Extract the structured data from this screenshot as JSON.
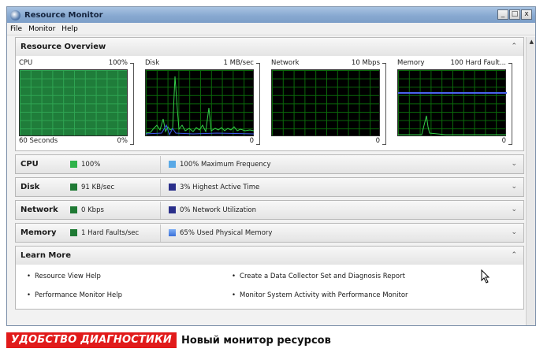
{
  "window": {
    "title": "Resource Monitor",
    "controls": [
      "_",
      "□",
      "x"
    ]
  },
  "menu": [
    "File",
    "Monitor",
    "Help"
  ],
  "overview": {
    "title": "Resource Overview",
    "graphs": {
      "cpu": {
        "name": "CPU",
        "max": "100%",
        "min": "0%",
        "duration": "60 Seconds"
      },
      "disk": {
        "name": "Disk",
        "max": "1 MB/sec",
        "min": "0"
      },
      "network": {
        "name": "Network",
        "max": "10 Mbps",
        "min": "0"
      },
      "memory": {
        "name": "Memory",
        "max": "100 Hard Fault...",
        "min": "0"
      }
    }
  },
  "sections": {
    "cpu": {
      "title": "CPU",
      "stat1": "100%",
      "stat2": "100% Maximum Frequency",
      "color1": "#2fb34a",
      "color2": "#5aa9e6"
    },
    "disk": {
      "title": "Disk",
      "stat1": "91 KB/sec",
      "stat2": "3% Highest Active Time",
      "color1": "#1f7a34",
      "color2": "#2a2f8a"
    },
    "network": {
      "title": "Network",
      "stat1": "0 Kbps",
      "stat2": "0% Network Utilization",
      "color1": "#1f7a34",
      "color2": "#2a2f8a"
    },
    "memory": {
      "title": "Memory",
      "stat1": "1 Hard Faults/sec",
      "stat2": "65% Used Physical Memory",
      "color1": "#1f7a34",
      "color2": "#3a6fd8"
    }
  },
  "learn_more": {
    "title": "Learn More",
    "links": [
      "Resource View Help",
      "Create a Data Collector Set and Diagnosis Report",
      "Performance Monitor Help",
      "Monitor System Activity with Performance Monitor"
    ]
  },
  "caption": {
    "tag": "УДОБСТВО ДИАГНОСТИКИ",
    "text": "Новый монитор ресурсов",
    "tag_color": "#e11a1a"
  },
  "icons": [
    "app-icon",
    "chevron-up-icon",
    "chevron-down-icon",
    "cursor-icon"
  ]
}
